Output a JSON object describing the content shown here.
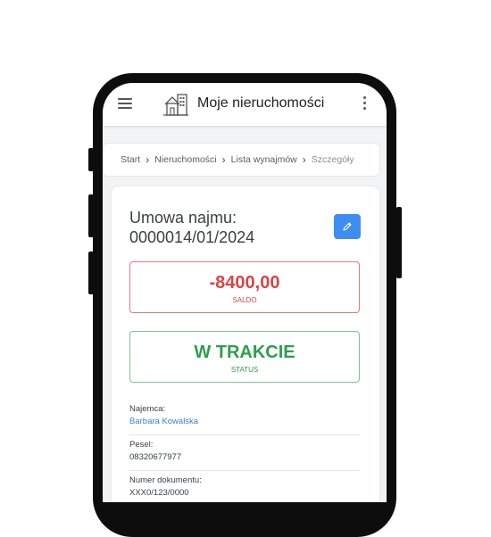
{
  "app": {
    "title": "Moje nieruchomości",
    "icons": {
      "menu": "hamburger-icon",
      "logo": "house-icon",
      "more": "kebab-icon",
      "edit": "pencil-icon"
    }
  },
  "breadcrumb": {
    "items": [
      "Start",
      "Nieruchomości",
      "Lista wynajmów",
      "Szczegóły"
    ]
  },
  "contract": {
    "title_line1": "Umowa najmu:",
    "title_line2": "0000014/01/2024",
    "saldo_value": "-8400,00",
    "saldo_label": "SALDO",
    "status_value": "W TRAKCIE",
    "status_label": "STATUS"
  },
  "details": {
    "tenant_label": "Najemca:",
    "tenant_value": "Barbara Kowalska",
    "pesel_label": "Pesel:",
    "pesel_value": "08320677977",
    "doc_label": "Numer dokumentu:",
    "doc_value": "XXX0/123/0000"
  },
  "colors": {
    "accent": "#3d8ef0",
    "negative": "#d64545",
    "positive": "#2e9e4c",
    "link": "#3d7fd9"
  }
}
